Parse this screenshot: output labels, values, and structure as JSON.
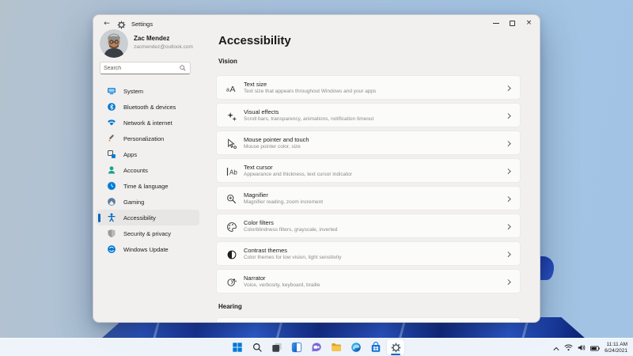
{
  "titlebar": {
    "app_title": "Settings",
    "controls": {
      "minimize": "minimize",
      "maximize": "maximize",
      "close": "×"
    }
  },
  "user": {
    "name": "Zac Mendez",
    "email": "zacmendez@outlook.com"
  },
  "search": {
    "placeholder": "Search"
  },
  "nav": {
    "selected_index": 8,
    "items": [
      {
        "label": "System",
        "icon": "system-icon"
      },
      {
        "label": "Bluetooth & devices",
        "icon": "bluetooth-icon"
      },
      {
        "label": "Network & internet",
        "icon": "network-icon"
      },
      {
        "label": "Personalization",
        "icon": "personalization-icon"
      },
      {
        "label": "Apps",
        "icon": "apps-icon"
      },
      {
        "label": "Accounts",
        "icon": "accounts-icon"
      },
      {
        "label": "Time & language",
        "icon": "time-language-icon"
      },
      {
        "label": "Gaming",
        "icon": "gaming-icon"
      },
      {
        "label": "Accessibility",
        "icon": "accessibility-icon"
      },
      {
        "label": "Security & privacy",
        "icon": "security-icon"
      },
      {
        "label": "Windows Update",
        "icon": "windows-update-icon"
      }
    ]
  },
  "page": {
    "title": "Accessibility",
    "sections": {
      "vision": "Vision",
      "hearing": "Hearing"
    },
    "rows": [
      {
        "title": "Text size",
        "subtitle": "Text size that appears throughout Windows and your apps",
        "icon": "text-size-icon"
      },
      {
        "title": "Visual effects",
        "subtitle": "Scroll bars, transparency, animations, notification timeout",
        "icon": "visual-effects-icon"
      },
      {
        "title": "Mouse pointer and touch",
        "subtitle": "Mouse pointer color, size",
        "icon": "mouse-pointer-icon"
      },
      {
        "title": "Text cursor",
        "subtitle": "Appearance and thickness, text cursor indicator",
        "icon": "text-cursor-icon"
      },
      {
        "title": "Magnifier",
        "subtitle": "Magnifier reading, zoom increment",
        "icon": "magnifier-icon"
      },
      {
        "title": "Color filters",
        "subtitle": "Colorblindness filters, grayscale, inverted",
        "icon": "color-filters-icon"
      },
      {
        "title": "Contrast themes",
        "subtitle": "Color themes for low vision, light sensitivity",
        "icon": "contrast-themes-icon"
      },
      {
        "title": "Narrator",
        "subtitle": "Voice, verbosity, keyboard, braille",
        "icon": "narrator-icon"
      }
    ]
  },
  "taskbar": {
    "items": [
      "start",
      "search",
      "task-view",
      "widgets",
      "chat",
      "file-explorer",
      "edge",
      "store",
      "settings"
    ],
    "active_item": "settings",
    "tray": {
      "time": "11:11 AM",
      "date": "6/24/2021",
      "icons": [
        "chevron-up",
        "wifi",
        "volume",
        "battery"
      ]
    }
  },
  "colors": {
    "accent": "#0067C0",
    "window_bg": "#F2F0EE",
    "card_bg": "#FBFBFA",
    "desktop": "#A4C4E3",
    "taskbar": "#F1F6FC"
  },
  "icons_map": {
    "back-icon": "←",
    "gear-icon": "⚙ gear shape",
    "search-icon": "magnifier",
    "minimize-icon": "horizontal bar",
    "maximize-icon": "square outline",
    "close-icon": "×",
    "chevron-right-icon": "›",
    "chevron-up-icon": "^",
    "start-icon": "four blue squares",
    "task-view-icon": "overlapping squares",
    "widgets-icon": "split panel",
    "chat-icon": "purple bubble",
    "file-explorer-icon": "yellow folder",
    "edge-icon": "blue swirl circle",
    "store-icon": "blue shopping bag",
    "wifi-icon": "arcs",
    "volume-icon": "speaker",
    "battery-icon": "battery body"
  }
}
